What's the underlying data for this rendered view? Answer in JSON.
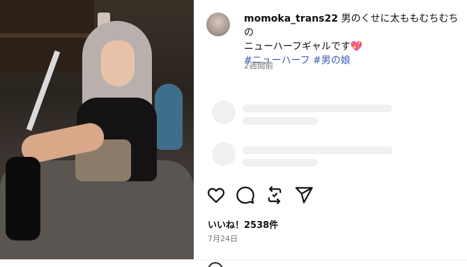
{
  "post": {
    "username": "momoka_trans22",
    "caption_line1": "男のくせに太ももむちむちの",
    "caption_line2": "ニューハーフギャルです",
    "caption_emoji": "💖",
    "hashtags": "#ニューハーフ #男の娘",
    "time_ago": "2週間前",
    "likes": "いいね！2538件",
    "date": "7月24日"
  },
  "icons": {
    "like": "heart-icon",
    "comment": "comment-icon",
    "share": "share-icon",
    "send": "send-icon"
  },
  "colors": {
    "hashtag": "#3b5fb3",
    "emoji_heart": "#e0557a",
    "muted_text": "#737373"
  }
}
